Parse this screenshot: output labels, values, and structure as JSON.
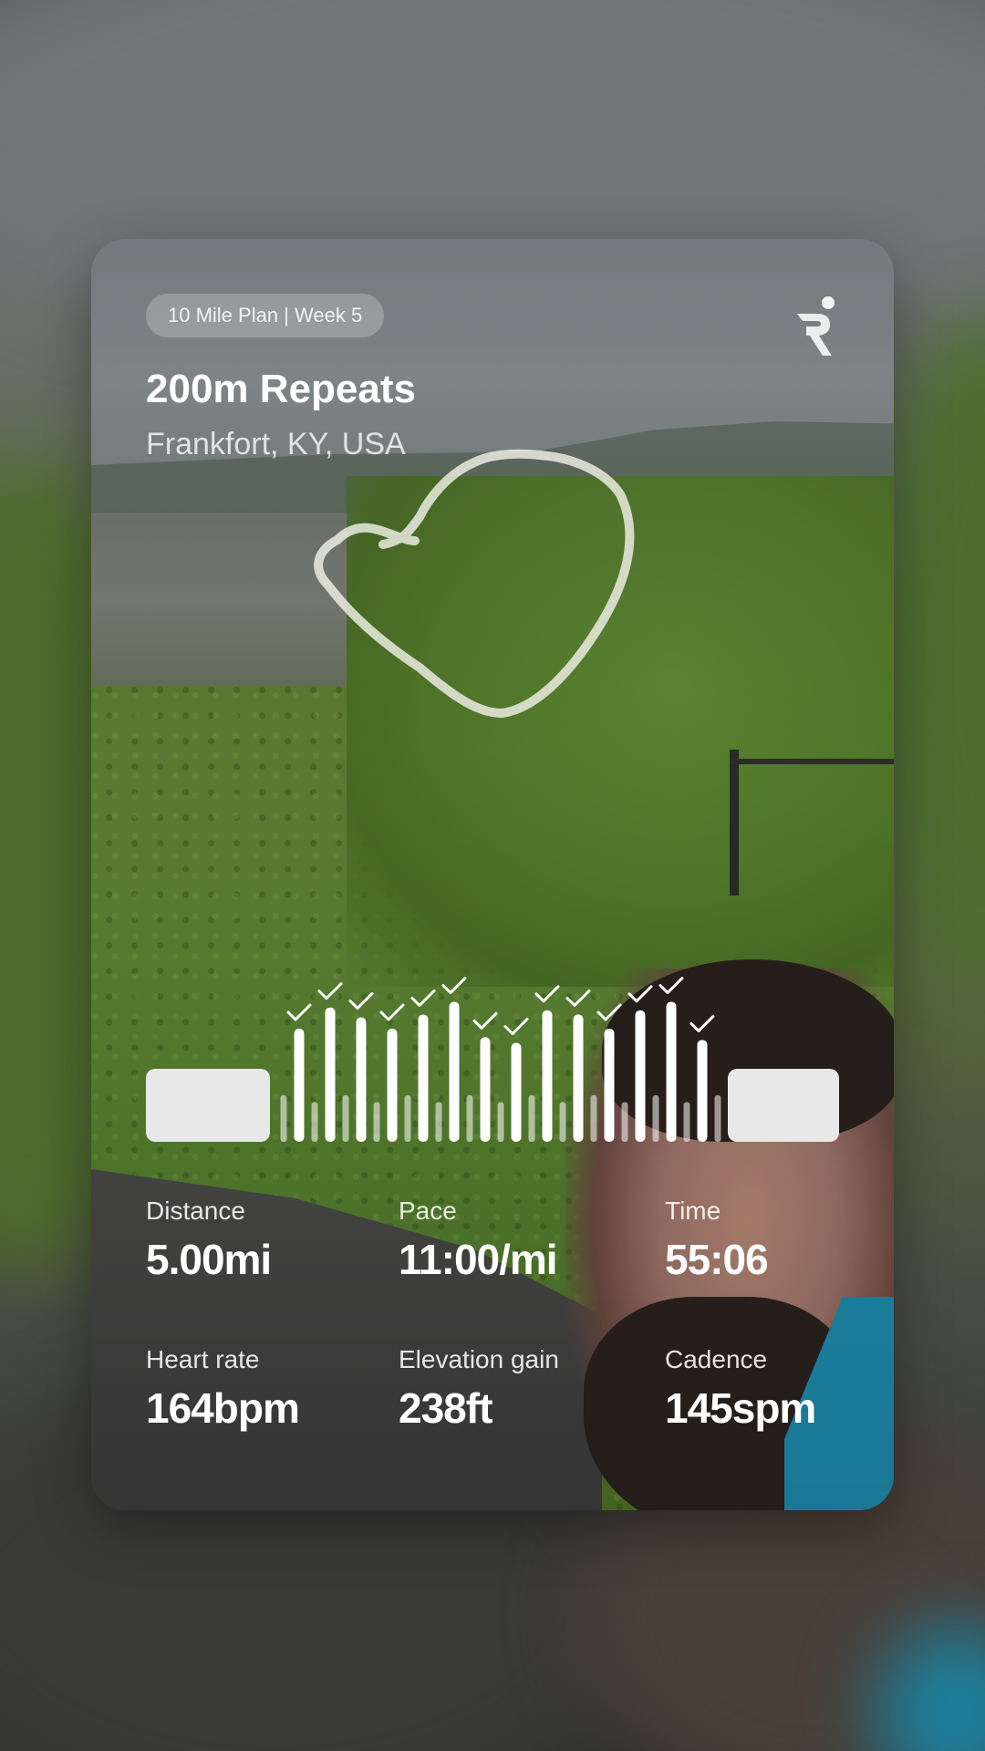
{
  "card": {
    "plan_badge": "10 Mile Plan | Week 5",
    "title": "200m Repeats",
    "location": "Frankfort, KY, USA",
    "logo_icon": "runna-logo-icon"
  },
  "stats": [
    {
      "label": "Distance",
      "value": "5.00mi"
    },
    {
      "label": "Pace",
      "value": "11:00/mi"
    },
    {
      "label": "Time",
      "value": "55:06"
    },
    {
      "label": "Heart rate",
      "value": "164bpm"
    },
    {
      "label": "Elevation gain",
      "value": "238ft"
    },
    {
      "label": "Cadence",
      "value": "145spm"
    }
  ],
  "chart_data": {
    "type": "bar",
    "description_units": "relative intensity 0-1",
    "segments": [
      {
        "kind": "warmup"
      },
      {
        "kind": "interval",
        "value": 0.8,
        "completed": true
      },
      {
        "kind": "interval",
        "value": 0.95,
        "completed": true
      },
      {
        "kind": "interval",
        "value": 0.88,
        "completed": true
      },
      {
        "kind": "interval",
        "value": 0.8,
        "completed": true
      },
      {
        "kind": "interval",
        "value": 0.9,
        "completed": true
      },
      {
        "kind": "interval",
        "value": 0.99,
        "completed": true
      },
      {
        "kind": "interval",
        "value": 0.74,
        "completed": true
      },
      {
        "kind": "interval",
        "value": 0.7,
        "completed": true
      },
      {
        "kind": "interval",
        "value": 0.93,
        "completed": true
      },
      {
        "kind": "interval",
        "value": 0.9,
        "completed": true
      },
      {
        "kind": "interval",
        "value": 0.8,
        "completed": true
      },
      {
        "kind": "interval",
        "value": 0.93,
        "completed": true
      },
      {
        "kind": "interval",
        "value": 0.99,
        "completed": true
      },
      {
        "kind": "interval",
        "value": 0.72,
        "completed": true
      },
      {
        "kind": "cooldown"
      }
    ],
    "recovery_value": 0.33,
    "check_icon": "checkmark-icon",
    "colors": {
      "bar": "#ffffff",
      "recovery": "rgba(255,255,255,0.55)",
      "block": "#e8e8e8"
    }
  },
  "route_icon": "route-map-icon"
}
